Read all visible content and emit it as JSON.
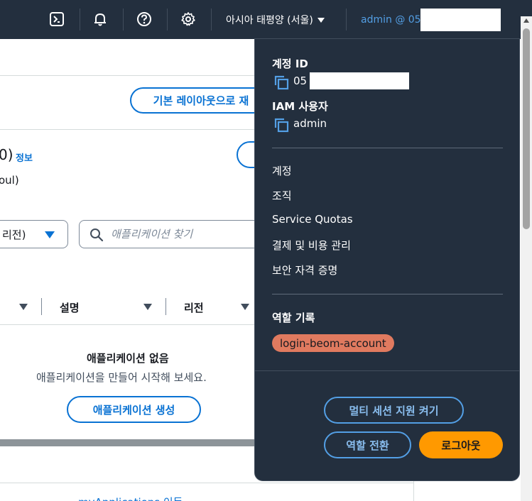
{
  "topbar": {
    "region_label": "아시아 태평양 (서울)",
    "account_label": "admin @ 05",
    "icons": [
      "cloudshell-icon",
      "bell-icon",
      "help-icon",
      "gear-icon"
    ]
  },
  "background": {
    "default_layout_button": "기본 레이아웃으로 재",
    "count_fragment": "0)",
    "info_link": "정보",
    "region_fragment": "oul)",
    "region_select_value": "리전)",
    "search_placeholder": "애플리케이션 찾기",
    "col_description": "설명",
    "col_region": "리전",
    "empty_title": "애플리케이션 없음",
    "empty_desc": "애플리케이션을 만들어 시작해 보세요.",
    "create_button": "애플리케이션 생성",
    "bottom_link": "myApplications 이동"
  },
  "panel": {
    "account_id_label": "계정 ID",
    "account_id_prefix": "05",
    "iam_user_label": "IAM 사용자",
    "iam_user_value": "admin",
    "links": [
      "계정",
      "조직",
      "Service Quotas",
      "결제 및 비용 관리",
      "보안 자격 증명"
    ],
    "role_history_label": "역할 기록",
    "role_name": "login-beom-account",
    "multi_session_button": "멀티 세션 지원 켜기",
    "switch_role_button": "역할 전환",
    "logout_button": "로그아웃"
  },
  "colors": {
    "nav_bg": "#232f3e",
    "accent_blue": "#0972d3",
    "link_blue_dark": "#539fe5",
    "logout_orange": "#ff9900",
    "role_badge": "#e07a5f"
  }
}
